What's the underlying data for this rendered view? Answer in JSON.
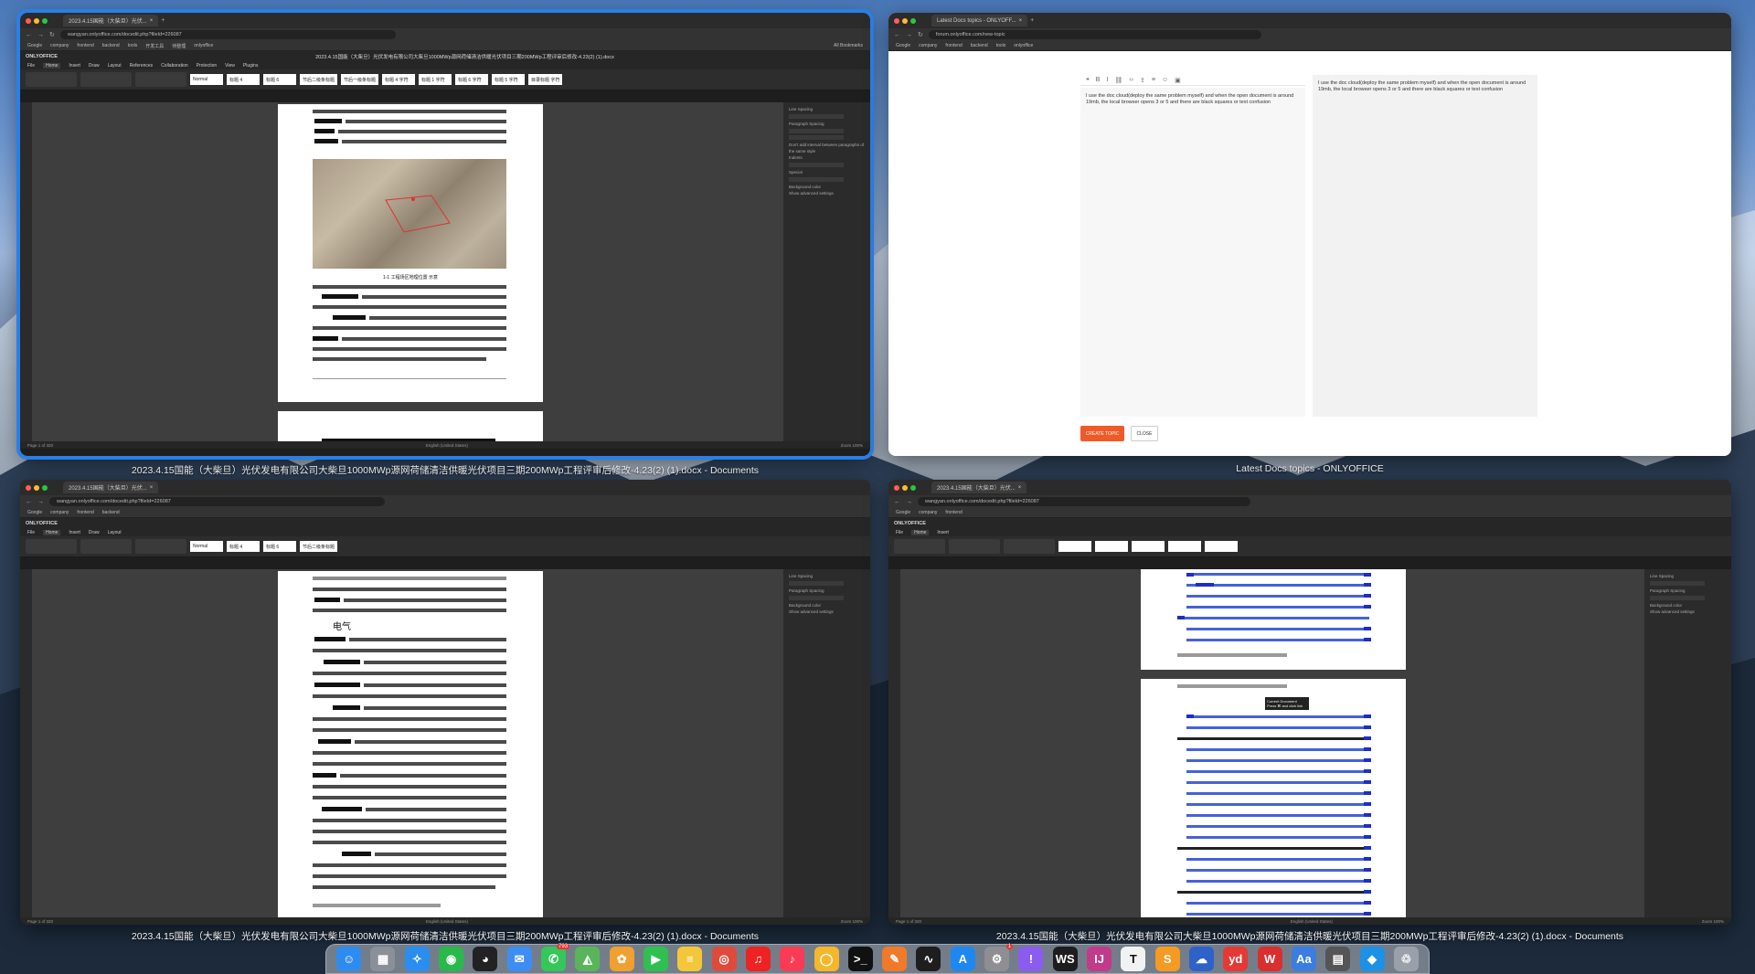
{
  "windows": [
    {
      "id": "w1",
      "title": "2023.4.15国能（大柴旦）光伏发电有限公司大柴旦1000MWp源网荷储清洁供暖光伏项目三期200MWp工程评审后修改-4.23(2) (1).docx - Documents",
      "tab": "2023.4.15国能（大柴旦）光伏...",
      "url": "wangyan.onlyoffice.com/docedit.php?fileId=226087",
      "doc_title": "2023.4.15国能（大柴旦）光伏发电有限公司大柴旦1000MWp源网荷储清洁供暖光伏项目三期200MWp工程评审后修改-4.23(2) (1).docx",
      "caption": "1-1  工程场区地理位置    示意",
      "status_left": "Page 1 of 320",
      "status_right": "Zoom 100%"
    },
    {
      "id": "w2",
      "title": "Latest Docs topics - ONLYOFFICE",
      "tab": "Latest Docs topics - ONLYOFF...",
      "url": "forum.onlyoffice.com/new-topic",
      "editor_text": "I use the doc cloud(deploy the same problem myself) and when the open document is around 19mb, the local browser opens 3 or 5 and there are black squares or text confusion",
      "preview_text": "I use the doc cloud(deploy the same problem myself) and when the open document is around 19mb, the local browser opens 3 or 5 and there are black squares or text confusion",
      "create_btn": "CREATE TOPIC",
      "close_btn": "CLOSE"
    },
    {
      "id": "w3",
      "title": "2023.4.15国能（大柴旦）光伏发电有限公司大柴旦1000MWp源网荷储清洁供暖光伏项目三期200MWp工程评审后修改-4.23(2) (1).docx - Documents",
      "tab": "2023.4.15国能（大柴旦）光伏...",
      "heading": "电气",
      "status_left": "Page 1 of 320",
      "status_right": "Zoom 100%"
    },
    {
      "id": "w4",
      "title": "2023.4.15国能（大柴旦）光伏发电有限公司大柴旦1000MWp源网荷储清洁供暖光伏项目三期200MWp工程评审后修改-4.23(2) (1).docx - Documents",
      "tab": "2023.4.15国能（大柴旦）光伏...",
      "tooltip": "Current Document\nPress ⌘ and click link",
      "status_left": "Page 1 of 320",
      "status_right": "Zoom 100%"
    }
  ],
  "ui": {
    "app_name": "ONLYOFFICE",
    "menu": [
      "File",
      "Home",
      "Insert",
      "Draw",
      "Layout",
      "References",
      "Collaboration",
      "Protection",
      "View",
      "Plugins"
    ],
    "styles": [
      "Normal",
      "标题 4",
      "标题 6",
      "节后二级条标题",
      "节后一级条标题",
      "标题 4 字符",
      "标题 1 字符",
      "标题 6 字符",
      "标题 5 字符",
      "目录标题 字符"
    ],
    "bookmarks": [
      "Google",
      "company",
      "frontend",
      "backend",
      "tools",
      "开发工具",
      "待整理",
      "onlyoffice"
    ],
    "all_bookmarks": "All Bookmarks",
    "right_panel": [
      "Line Spacing",
      "Multiple",
      "Paragraph Spacing",
      "Before",
      "After",
      "Don't add interval between paragraphs of the same style",
      "Indents",
      "Left",
      "Right",
      "Special",
      "Background color",
      "Show advanced settings"
    ],
    "status_lang": "English (United States)",
    "word_count": "Word count"
  },
  "dock": [
    {
      "name": "finder",
      "glyph": "☺",
      "color": "#2e8cf0"
    },
    {
      "name": "launchpad",
      "glyph": "▦",
      "color": "#8a8f9a"
    },
    {
      "name": "safari",
      "glyph": "✧",
      "color": "#2a8ef0"
    },
    {
      "name": "wechat",
      "glyph": "◉",
      "color": "#29b94a"
    },
    {
      "name": "qq",
      "glyph": "◕",
      "color": "#222"
    },
    {
      "name": "mail",
      "glyph": "✉",
      "color": "#3c8ef5"
    },
    {
      "name": "messages",
      "glyph": "✆",
      "color": "#34c759",
      "badge": "793"
    },
    {
      "name": "maps",
      "glyph": "◭",
      "color": "#5ab55a"
    },
    {
      "name": "photos",
      "glyph": "✿",
      "color": "#f0a030"
    },
    {
      "name": "facetime",
      "glyph": "▶",
      "color": "#30c050"
    },
    {
      "name": "notes",
      "glyph": "≡",
      "color": "#f4c73a"
    },
    {
      "name": "chrome",
      "glyph": "◎",
      "color": "#e04a3a"
    },
    {
      "name": "netease-music",
      "glyph": "♫",
      "color": "#e22"
    },
    {
      "name": "music",
      "glyph": "♪",
      "color": "#fa3b55"
    },
    {
      "name": "qq-browser",
      "glyph": "◯",
      "color": "#f5b72a"
    },
    {
      "name": "terminal",
      "glyph": ">_",
      "color": "#111"
    },
    {
      "name": "pencil",
      "glyph": "✎",
      "color": "#f07a2a"
    },
    {
      "name": "activity-monitor",
      "glyph": "∿",
      "color": "#1e1e1e"
    },
    {
      "name": "app-store",
      "glyph": "A",
      "color": "#1e88f2"
    },
    {
      "name": "system-settings",
      "glyph": "⚙",
      "color": "#8e8e93",
      "badge": "1"
    },
    {
      "name": "feedback",
      "glyph": "!",
      "color": "#8a5cf0"
    },
    {
      "name": "webstorm",
      "glyph": "WS",
      "color": "#1d1d1d"
    },
    {
      "name": "intellij",
      "glyph": "IJ",
      "color": "#c23a8a"
    },
    {
      "name": "typora",
      "glyph": "T",
      "color": "#f2f2f2"
    },
    {
      "name": "sublime",
      "glyph": "S",
      "color": "#f59a23"
    },
    {
      "name": "sourcetree",
      "glyph": "☁",
      "color": "#2e62c8"
    },
    {
      "name": "youdao",
      "glyph": "yd",
      "color": "#e53935"
    },
    {
      "name": "wps",
      "glyph": "W",
      "color": "#d92f2f"
    },
    {
      "name": "dictionary",
      "glyph": "Aa",
      "color": "#3b7de0"
    },
    {
      "name": "calculator",
      "glyph": "▤",
      "color": "#555"
    },
    {
      "name": "docker",
      "glyph": "◆",
      "color": "#1d91e6"
    },
    {
      "name": "trash",
      "glyph": "♲",
      "color": "#9aa0aa"
    }
  ]
}
